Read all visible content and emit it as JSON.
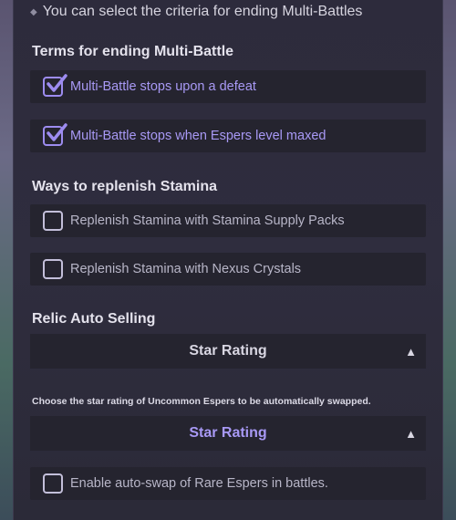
{
  "intro": "You can select the criteria for ending Multi-Battles",
  "terms": {
    "title": "Terms for ending Multi-Battle",
    "options": [
      {
        "label": "Multi-Battle stops upon a defeat",
        "checked": true
      },
      {
        "label": "Multi-Battle stops when Espers level maxed",
        "checked": true
      }
    ]
  },
  "stamina": {
    "title": "Ways to replenish Stamina",
    "options": [
      {
        "label": "Replenish Stamina with Stamina Supply Packs",
        "checked": false
      },
      {
        "label": "Replenish Stamina with Nexus Crystals",
        "checked": false
      }
    ]
  },
  "relic": {
    "title": "Relic Auto Selling",
    "select_label": "Star Rating",
    "select_icon": "triangle-up-icon"
  },
  "swap": {
    "note": "Choose the star rating of Uncommon Espers to be automatically swapped.",
    "select_label": "Star Rating",
    "select_icon": "triangle-up-icon",
    "rare_option": {
      "label": "Enable auto-swap of Rare Espers in battles.",
      "checked": false
    }
  },
  "colors": {
    "accent": "#a899f5",
    "panel": "#2d2b3c",
    "row": "#25242f"
  }
}
